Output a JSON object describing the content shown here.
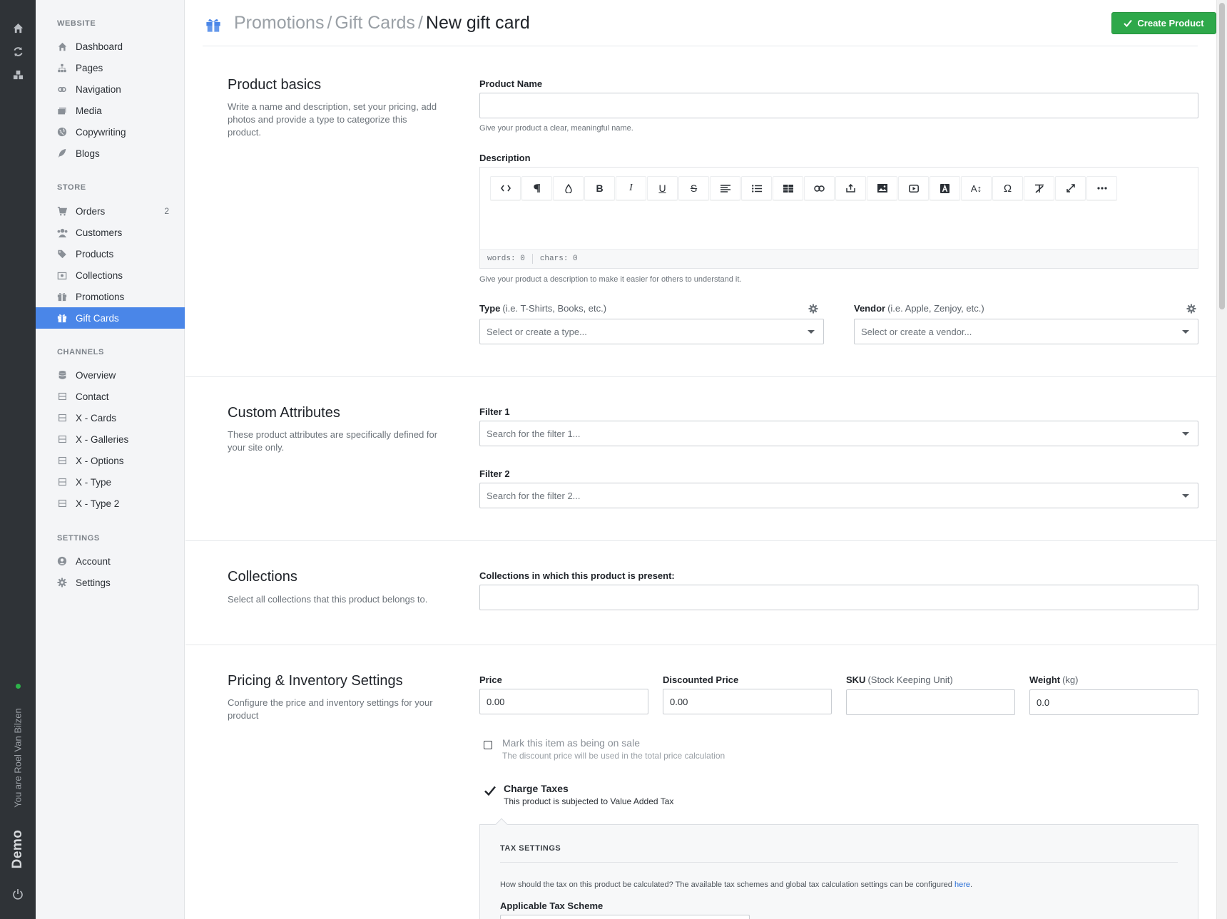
{
  "rail": {
    "user_text": "You are Roel Van Bilzen",
    "brand": "Demo"
  },
  "sidebar": {
    "sections": [
      {
        "title": "WEBSITE",
        "items": [
          {
            "label": "Dashboard",
            "icon": "home-icon"
          },
          {
            "label": "Pages",
            "icon": "sitemap-icon"
          },
          {
            "label": "Navigation",
            "icon": "link-icon"
          },
          {
            "label": "Media",
            "icon": "images-icon"
          },
          {
            "label": "Copywriting",
            "icon": "globe-icon"
          },
          {
            "label": "Blogs",
            "icon": "feather-icon"
          }
        ]
      },
      {
        "title": "STORE",
        "items": [
          {
            "label": "Orders",
            "icon": "cart-icon",
            "count": "2"
          },
          {
            "label": "Customers",
            "icon": "users-icon"
          },
          {
            "label": "Products",
            "icon": "tags-icon"
          },
          {
            "label": "Collections",
            "icon": "collection-icon"
          },
          {
            "label": "Promotions",
            "icon": "gift-icon"
          },
          {
            "label": "Gift Cards",
            "icon": "gift-card-icon",
            "active": true
          }
        ]
      },
      {
        "title": "CHANNELS",
        "items": [
          {
            "label": "Overview",
            "icon": "database-icon"
          },
          {
            "label": "Contact",
            "icon": "box-icon"
          },
          {
            "label": "X - Cards",
            "icon": "box-icon"
          },
          {
            "label": "X - Galleries",
            "icon": "box-icon"
          },
          {
            "label": "X - Options",
            "icon": "box-icon"
          },
          {
            "label": "X - Type",
            "icon": "box-icon"
          },
          {
            "label": "X - Type 2",
            "icon": "box-icon"
          }
        ]
      },
      {
        "title": "SETTINGS",
        "items": [
          {
            "label": "Account",
            "icon": "user-circle-icon"
          },
          {
            "label": "Settings",
            "icon": "gear-icon"
          }
        ]
      }
    ]
  },
  "header": {
    "crumb1": "Promotions",
    "crumb2": "Gift Cards",
    "current": "New gift card",
    "separator": "/",
    "create_label": "Create Product"
  },
  "basics": {
    "title": "Product basics",
    "desc": "Write a name and description, set your pricing, add photos and provide a type to categorize this product.",
    "name_label": "Product Name",
    "name_value": "",
    "name_help": "Give your product a clear, meaningful name.",
    "desc_label": "Description",
    "words": "words: 0",
    "chars": "chars: 0",
    "desc_help": "Give your product a description to make it easier for others to understand it.",
    "type_label": "Type",
    "type_hint": "(i.e. T-Shirts, Books, etc.)",
    "type_placeholder": "Select or create a type...",
    "vendor_label": "Vendor",
    "vendor_hint": "(i.e. Apple, Zenjoy, etc.)",
    "vendor_placeholder": "Select or create a vendor..."
  },
  "toolbar_buttons": [
    "code-view",
    "paragraph",
    "color",
    "bold",
    "italic",
    "underline",
    "strikethrough",
    "align",
    "unordered-list",
    "table",
    "link",
    "upload",
    "image",
    "video",
    "font",
    "font-size",
    "special-char",
    "clear-format",
    "fullscreen",
    "more"
  ],
  "custom": {
    "title": "Custom Attributes",
    "desc": "These product attributes are specifically defined for your site only.",
    "filter1_label": "Filter 1",
    "filter1_placeholder": "Search for the filter 1...",
    "filter2_label": "Filter 2",
    "filter2_placeholder": "Search for the filter 2..."
  },
  "collections": {
    "title": "Collections",
    "desc": "Select all collections that this product belongs to.",
    "label": "Collections in which this product is present:"
  },
  "pricing": {
    "title": "Pricing & Inventory Settings",
    "desc": "Configure the price and inventory settings for your product",
    "price_label": "Price",
    "price_value": "0.00",
    "discount_label": "Discounted Price",
    "discount_value": "0.00",
    "sku_label": "SKU",
    "sku_hint": "(Stock Keeping Unit)",
    "sku_value": "",
    "weight_label": "Weight",
    "weight_hint": "(kg)",
    "weight_value": "0.0",
    "sale_title": "Mark this item as being on sale",
    "sale_sub": "The discount price will be used in the total price calculation",
    "sale_checked": false,
    "tax_title": "Charge Taxes",
    "tax_sub": "This product is subjected to Value Added Tax",
    "tax_checked": true
  },
  "tax_settings": {
    "title": "TAX SETTINGS",
    "desc": "How should the tax on this product be calculated? The available tax schemes and global tax calculation settings can be configured",
    "link": "here",
    "period": ".",
    "scheme_label": "Applicable Tax Scheme"
  },
  "colors": {
    "accent": "#4a86e8",
    "success": "#2ea84a",
    "rail": "#2f3337"
  }
}
